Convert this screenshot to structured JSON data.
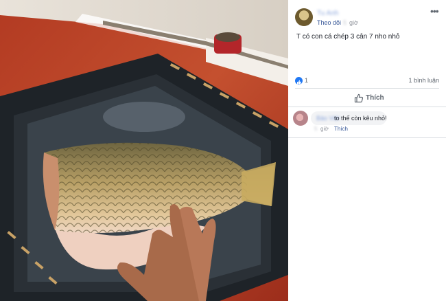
{
  "post": {
    "author_name": "Tu Anh",
    "follow_label": "Theo dõi",
    "separator": "·",
    "time_value": "5",
    "time_unit": "giờ",
    "more_icon": "•••",
    "text": "T có con cá chép 3 cân 7 nho nhỏ"
  },
  "stats": {
    "like_count": "1",
    "comment_count": "1 bình luận"
  },
  "actions": {
    "like_label": "Thích"
  },
  "comments": [
    {
      "author": "Bảo Việt",
      "text": "to thế còn kêu nhỏ!",
      "time_value": "5",
      "time_unit": "giờ",
      "separator": "·",
      "like_label": "Thích"
    }
  ],
  "colors": {
    "link_blue": "#385898",
    "reaction_blue": "#2078f4",
    "text_dark": "#1d2129",
    "muted_gray": "#606770"
  }
}
